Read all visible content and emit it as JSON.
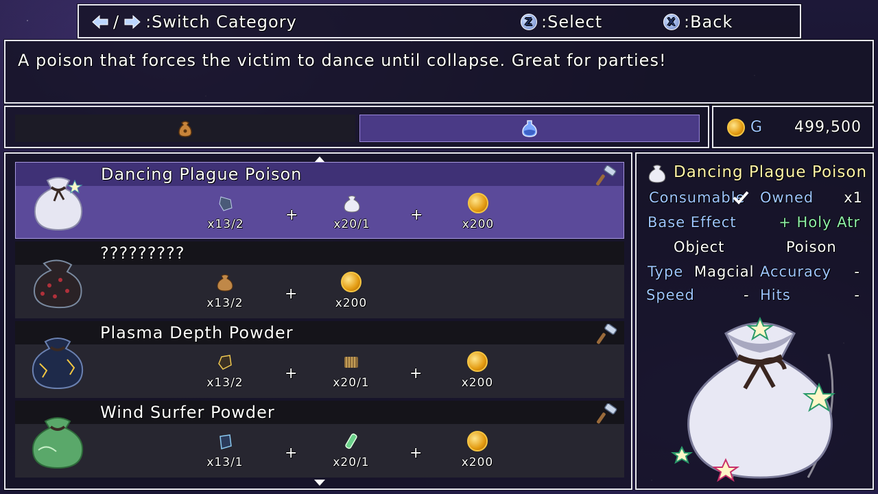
{
  "controls": {
    "switch_keys": "/",
    "switch_label": ":Switch Category",
    "select_key": "Z",
    "select_label": ":Select",
    "back_key": "X",
    "back_label": ":Back"
  },
  "description": "A poison that forces the victim to dance until collapse. Great for parties!",
  "categories": [
    {
      "icon": "pouch-icon",
      "selected": false
    },
    {
      "icon": "potion-flask-icon",
      "selected": true
    }
  ],
  "gold": {
    "label": "G",
    "amount": "499,500"
  },
  "recipes": [
    {
      "name": "Dancing Plague Poison",
      "icon": "white-pouch-icon",
      "selected": true,
      "craftable": true,
      "ingredients": [
        {
          "icon": "dark-shard-icon",
          "qty": "x13/2"
        },
        {
          "icon": "white-pouch-icon",
          "qty": "x20/1"
        },
        {
          "icon": "gold-coin-icon",
          "qty": "x200"
        }
      ]
    },
    {
      "name": "?????????",
      "icon": "dark-pouch-icon",
      "selected": false,
      "craftable": false,
      "ingredients": [
        {
          "icon": "brown-pouch-icon",
          "qty": "x13/2"
        },
        {
          "icon": "gold-coin-icon",
          "qty": "x200"
        }
      ]
    },
    {
      "name": "Plasma Depth Powder",
      "icon": "navy-pouch-icon",
      "selected": false,
      "craftable": true,
      "ingredients": [
        {
          "icon": "golden-shard-icon",
          "qty": "x13/2"
        },
        {
          "icon": "striped-cloth-icon",
          "qty": "x20/1"
        },
        {
          "icon": "gold-coin-icon",
          "qty": "x200"
        }
      ]
    },
    {
      "name": "Wind Surfer Powder",
      "icon": "green-pouch-icon",
      "selected": false,
      "craftable": true,
      "ingredients": [
        {
          "icon": "blue-shard-icon",
          "qty": "x13/1"
        },
        {
          "icon": "green-vial-icon",
          "qty": "x20/1"
        },
        {
          "icon": "gold-coin-icon",
          "qty": "x200"
        }
      ]
    }
  ],
  "detail": {
    "title": "Dancing Plague Poison",
    "consumable_label": "Consumable",
    "owned_label": "Owned",
    "owned_value": "x1",
    "base_effect_label": "Base Effect",
    "base_effect_value": "+ Holy Atr",
    "object_label": "Object",
    "object_value": "Poison",
    "type_label": "Type",
    "type_value": "Magcial",
    "accuracy_label": "Accuracy",
    "accuracy_value": "-",
    "speed_label": "Speed",
    "speed_value": "-",
    "hits_label": "Hits",
    "hits_value": "-"
  },
  "colors": {
    "selected_row": "#5b4a9a",
    "label_blue": "#9ec4ff",
    "title_yellow": "#fff4a8"
  }
}
